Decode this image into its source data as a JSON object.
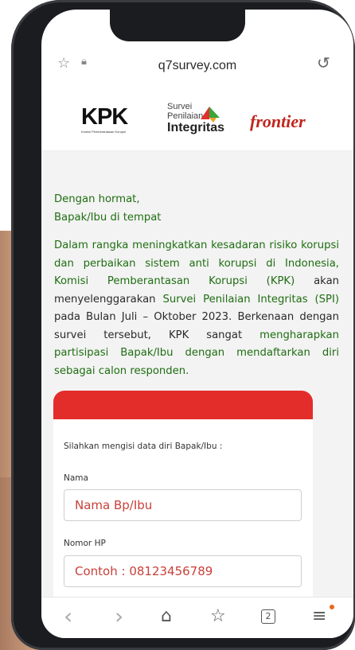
{
  "browser": {
    "url": "q7survey.com",
    "icons": [
      "star-icon",
      "lock-icon",
      "refresh-icon"
    ]
  },
  "logos": {
    "kpk_title": "KPK",
    "kpk_subtitle": "Komisi Pemberantasan Korupsi",
    "spi_line1": "Survei",
    "spi_line2": "Penilaian",
    "spi_line3": "Integritas",
    "frontier": "frontier"
  },
  "intro": {
    "greeting1": "Dengan hormat,",
    "greeting2": "Bapak/Ibu di tempat",
    "p1": "Dalam rangka meningkatkan kesadaran risiko korupsi dan perbaikan sistem anti korupsi di Indonesia, Komisi Pemberantasan Korupsi (KPK)",
    "p2": "akan menyelenggarakan",
    "p3": "Survei Penilaian Integritas (SPI)",
    "p4": "pada Bulan Juli – Oktober 2023.",
    "p5": "Berkenaan dengan survei tersebut, KPK sangat",
    "p6": "mengharapkan partisipasi Bapak/Ibu dengan mendaftarkan diri sebagai calon responden."
  },
  "form": {
    "instruction": "Silahkan mengisi data diri Bapak/Ibu :",
    "name_label": "Nama",
    "name_placeholder": "Nama Bp/Ibu",
    "phone_label": "Nomor HP",
    "phone_placeholder": "Contoh : 08123456789"
  },
  "toolbar": {
    "back": "‹",
    "forward": "›",
    "home": "⌂",
    "bookmarks": "☆",
    "tabs_count": "2",
    "menu": "≡"
  },
  "colors": {
    "accent_green": "#1f6e12",
    "card_red": "#e32d2a",
    "frontier_red": "#c0261d"
  }
}
